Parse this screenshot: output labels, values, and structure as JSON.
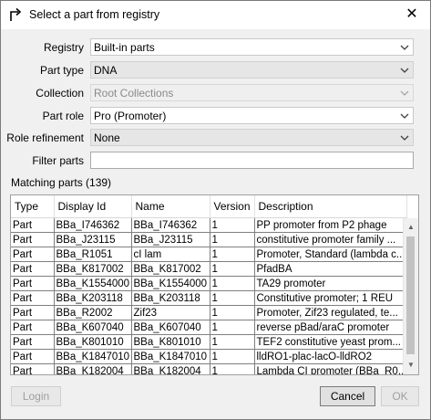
{
  "window": {
    "title": "Select a part from registry",
    "icon": "select-arrow-icon",
    "close_label": "✕"
  },
  "form": {
    "registry": {
      "label": "Registry",
      "value": "Built-in parts"
    },
    "part_type": {
      "label": "Part type",
      "value": "DNA"
    },
    "collection": {
      "label": "Collection",
      "value": "Root Collections"
    },
    "part_role": {
      "label": "Part role",
      "value": "Pro (Promoter)"
    },
    "role_refinement": {
      "label": "Role refinement",
      "value": "None"
    },
    "filter_parts": {
      "label": "Filter parts",
      "value": ""
    }
  },
  "matching": {
    "label": "Matching parts (139)",
    "columns": [
      "Type",
      "Display Id",
      "Name",
      "Version",
      "Description"
    ],
    "rows": [
      [
        "Part",
        "BBa_I746362",
        "BBa_I746362",
        "1",
        "PP promoter from P2 phage"
      ],
      [
        "Part",
        "BBa_J23115",
        "BBa_J23115",
        "1",
        "constitutive promoter family ..."
      ],
      [
        "Part",
        "BBa_R1051",
        "cI lam",
        "1",
        "Promoter, Standard (lambda c..."
      ],
      [
        "Part",
        "BBa_K817002",
        "BBa_K817002",
        "1",
        "PfadBA"
      ],
      [
        "Part",
        "BBa_K1554000",
        "BBa_K1554000",
        "1",
        "TA29 promoter"
      ],
      [
        "Part",
        "BBa_K203118",
        "BBa_K203118",
        "1",
        "Constitutive promoter; 1 REU"
      ],
      [
        "Part",
        "BBa_R2002",
        "Zif23",
        "1",
        "Promoter, Zif23 regulated, te..."
      ],
      [
        "Part",
        "BBa_K607040",
        "BBa_K607040",
        "1",
        "reverse pBad/araC promoter"
      ],
      [
        "Part",
        "BBa_K801010",
        "BBa_K801010",
        "1",
        "TEF2 constitutive yeast prom..."
      ],
      [
        "Part",
        "BBa_K1847010",
        "BBa_K1847010",
        "1",
        "lldRO1-plac-lacO-lldRO2"
      ],
      [
        "Part",
        "BBa_K182004",
        "BBa_K182004",
        "1",
        "Lambda CI promoter (BBa_R0..."
      ]
    ]
  },
  "buttons": {
    "login": "Login",
    "cancel": "Cancel",
    "ok": "OK"
  }
}
